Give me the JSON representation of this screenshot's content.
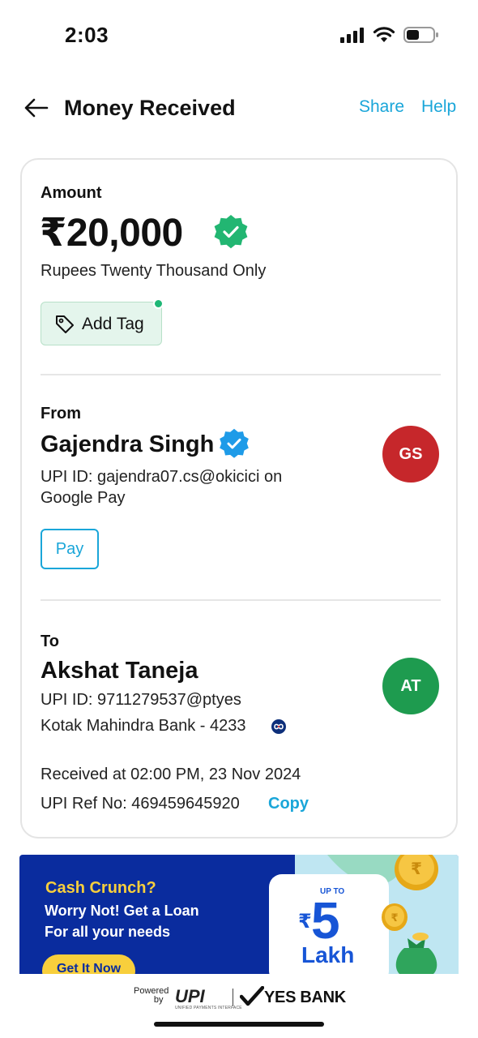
{
  "status_bar": {
    "time": "2:03"
  },
  "header": {
    "title": "Money Received",
    "share_label": "Share",
    "help_label": "Help"
  },
  "amount": {
    "label": "Amount",
    "value": "₹20,000",
    "in_words": "Rupees Twenty Thousand Only",
    "add_tag_label": "Add Tag"
  },
  "sender": {
    "label": "From",
    "name": "Gajendra Singh",
    "upi_line": "UPI ID: gajendra07.cs@okicici on Google Pay",
    "initials": "GS",
    "pay_label": "Pay"
  },
  "receiver": {
    "label": "To",
    "name": "Akshat Taneja",
    "upi_id": "UPI ID: 9711279537@ptyes",
    "bank": "Kotak Mahindra Bank - 4233",
    "initials": "AT"
  },
  "transaction": {
    "received_at": "Received at 02:00 PM, 23 Nov 2024",
    "ref_no": "UPI Ref No: 469459645920",
    "copy_label": "Copy"
  },
  "banner": {
    "title": "Cash Crunch?",
    "line1": "Worry Not! Get a Loan",
    "line2": "For all your needs",
    "cta": "Get It Now",
    "loan_upto": "UP TO",
    "loan_rupee": "₹",
    "loan_amount": "5",
    "loan_unit": "Lakh"
  },
  "footer": {
    "powered": "Powered",
    "by": "by",
    "upi_logo": "UPI",
    "upi_sub": "UNIFIED PAYMENTS INTERFACE",
    "bank_name": "YES BANK"
  },
  "colors": {
    "accent": "#1aa6d9",
    "verified_green": "#22b672",
    "verified_blue": "#1e9be8",
    "avatar_gs": "#c6272b",
    "avatar_at": "#1e9b4f",
    "banner_bg": "#0a2c9e",
    "banner_cta": "#f8cf3c"
  },
  "icons": [
    "signal-icon",
    "wifi-icon",
    "battery-icon",
    "back-arrow-icon",
    "verified-icon",
    "tag-icon",
    "bank-logo-icon",
    "coin-icon",
    "money-bag-icon",
    "checkmark-icon"
  ]
}
